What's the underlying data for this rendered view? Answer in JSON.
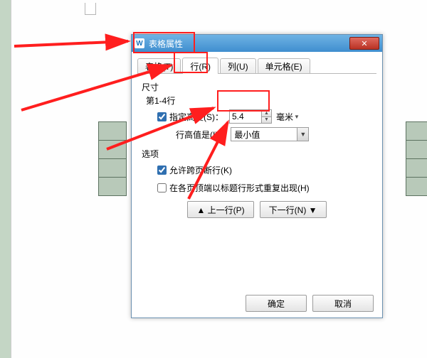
{
  "dialog": {
    "title": "表格属性",
    "close_glyph": "✕",
    "tabs": {
      "table": "表格(T)",
      "row": "行(R)",
      "column": "列(U)",
      "cell": "单元格(E)"
    },
    "size": {
      "heading": "尺寸",
      "range": "第1-4行",
      "specify_height": "指定高度(S)：",
      "height_value": "5.4",
      "unit": "毫米",
      "row_height_label": "行高值是(I)：",
      "row_height_value": "最小值"
    },
    "options": {
      "heading": "选项",
      "allow_break": "允许跨页断行(K)",
      "repeat_header": "在各页顶端以标题行形式重复出现(H)"
    },
    "nav": {
      "prev": "▲ 上一行(P)",
      "next": "下一行(N) ▼"
    },
    "footer": {
      "ok": "确定",
      "cancel": "取消"
    }
  }
}
